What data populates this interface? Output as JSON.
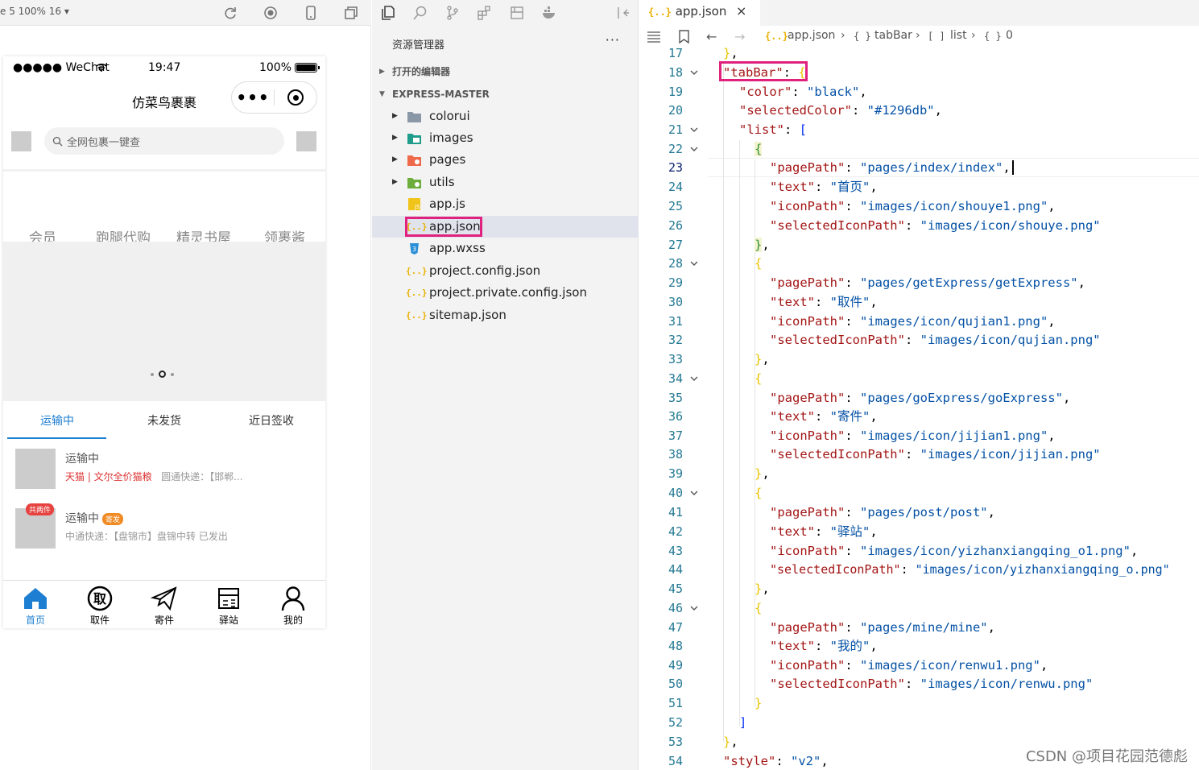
{
  "simulator": {
    "status_text": "e 5 100% 16 ▾",
    "phone": {
      "carrier": "●●●●● WeChat",
      "time": "19:47",
      "battery": "100%",
      "title": "仿菜鸟裹裹",
      "search_placeholder": "全网包裹一键查",
      "categories": [
        "会员",
        "跑腿代购",
        "精灵书屋",
        "领裹酱"
      ],
      "package_tabs": [
        "运输中",
        "未发货",
        "近日签收"
      ],
      "packages": [
        {
          "status": "运输中",
          "source": "天猫 | 文尔全价猫粮",
          "courier": "圆通快递：【邯郸..."
        },
        {
          "status": "运输中",
          "tag": "寄发",
          "badge": "共两件",
          "courier": "中通快递：【盘锦市】盘锦中转 已发出"
        }
      ],
      "tabbar": [
        "首页",
        "取件",
        "寄件",
        "驿站",
        "我的"
      ]
    }
  },
  "explorer": {
    "title": "资源管理器",
    "more": "···",
    "sections": {
      "open_editors": "打开的编辑器",
      "project": "EXPRESS-MASTER"
    },
    "items": [
      {
        "label": "colorui",
        "type": "folder"
      },
      {
        "label": "images",
        "type": "folder"
      },
      {
        "label": "pages",
        "type": "folder"
      },
      {
        "label": "utils",
        "type": "folder"
      },
      {
        "label": "app.js",
        "type": "js"
      },
      {
        "label": "app.json",
        "type": "json"
      },
      {
        "label": "app.wxss",
        "type": "css"
      },
      {
        "label": "project.config.json",
        "type": "json"
      },
      {
        "label": "project.private.config.json",
        "type": "json"
      },
      {
        "label": "sitemap.json",
        "type": "json"
      }
    ]
  },
  "editor": {
    "tab_icon": "{..}",
    "tab": "app.json",
    "tab_close": "×",
    "breadcrumbs": [
      "app.json",
      "tabBar",
      "list",
      "0"
    ],
    "breadcrumb_icons": [
      "{..}",
      "{ }",
      "[ ]",
      "{ }"
    ],
    "line_numbers": [
      "17",
      "18",
      "19",
      "20",
      "21",
      "22",
      "23",
      "24",
      "25",
      "26",
      "27",
      "28",
      "29",
      "30",
      "31",
      "32",
      "33",
      "34",
      "35",
      "36",
      "37",
      "38",
      "39",
      "40",
      "41",
      "42",
      "43",
      "44",
      "45",
      "46",
      "47",
      "48",
      "49",
      "50",
      "51",
      "52",
      "53",
      "54"
    ],
    "tokens": {
      "tabBar": "\"tabBar\"",
      "color": "\"color\"",
      "black": "\"black\"",
      "selectedColor": "\"selectedColor\"",
      "blue": "\"#1296db\"",
      "list": "\"list\"",
      "pagePath": "\"pagePath\"",
      "text": "\"text\"",
      "iconPath": "\"iconPath\"",
      "selectedIconPath": "\"selectedIconPath\"",
      "p1": "\"pages/index/index\"",
      "t1": "\"首页\"",
      "i1": "\"images/icon/shouye1.png\"",
      "s1": "\"images/icon/shouye.png\"",
      "p2": "\"pages/getExpress/getExpress\"",
      "t2": "\"取件\"",
      "i2": "\"images/icon/qujian1.png\"",
      "s2": "\"images/icon/qujian.png\"",
      "p3": "\"pages/goExpress/goExpress\"",
      "t3": "\"寄件\"",
      "i3": "\"images/icon/jijian1.png\"",
      "s3": "\"images/icon/jijian.png\"",
      "p4": "\"pages/post/post\"",
      "t4": "\"驿站\"",
      "i4": "\"images/icon/yizhanxiangqing_o1.png\"",
      "s4": "\"images/icon/yizhanxiangqing_o.png\"",
      "p5": "\"pages/mine/mine\"",
      "t5": "\"我的\"",
      "i5": "\"images/icon/renwu1.png\"",
      "s5": "\"images/icon/renwu.png\"",
      "style": "\"style\"",
      "v2": "\"v2\""
    }
  },
  "watermark": "CSDN @项目花园范德彪",
  "colors": {
    "highlight": "#e0217e",
    "accent": "#1e7fd2",
    "string": "#0451a5",
    "key": "#a31515"
  }
}
